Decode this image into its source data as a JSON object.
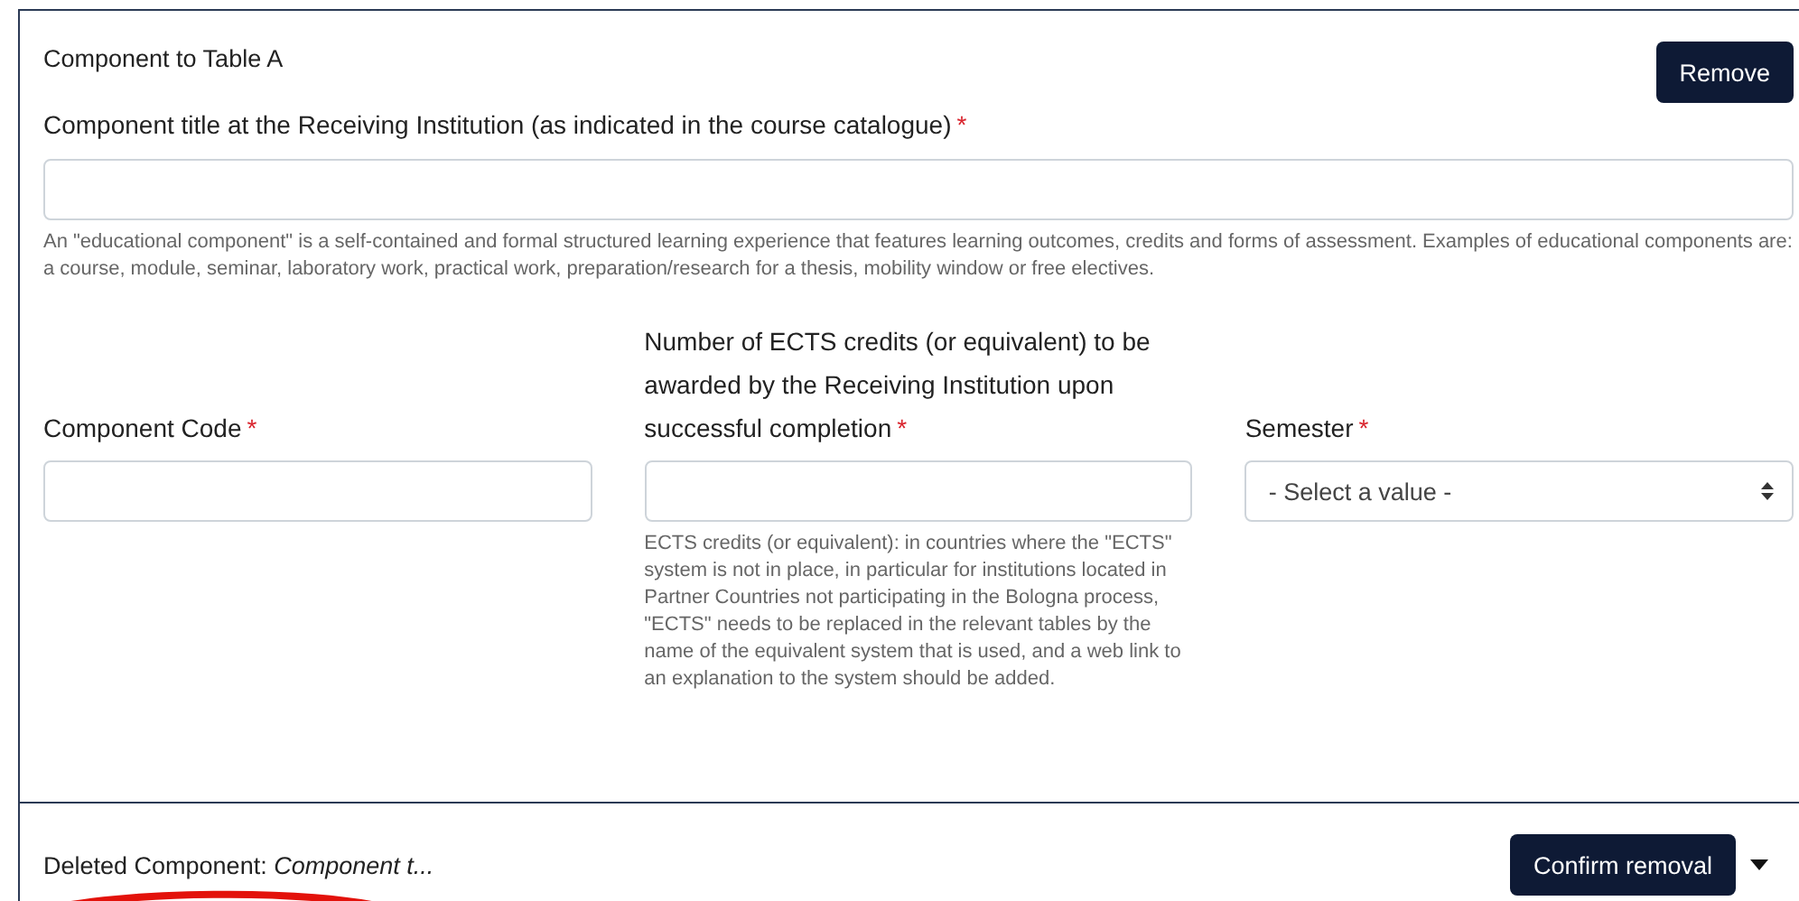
{
  "component": {
    "heading": "Component to Table A",
    "remove_button": "Remove",
    "title_field": {
      "label": "Component title at the Receiving Institution (as indicated in the course catalogue)",
      "required_mark": "*",
      "help": "An \"educational component\" is a self-contained and formal structured learning experience that features learning outcomes, credits and forms of assessment. Examples of educational components are: a course, module, seminar, laboratory work, practical work, preparation/research for a thesis, mobility window or free electives."
    },
    "fields": [
      {
        "kind": "text",
        "label": "Component Code",
        "required_mark": "*"
      },
      {
        "kind": "text",
        "label": "Number of ECTS credits (or equivalent) to be awarded by the Receiving Institution upon successful completion",
        "required_mark": "*",
        "help": "ECTS credits (or equivalent): in countries where the \"ECTS\" system is not in place, in particular for institutions located in Partner Countries not participating in the Bologna process, \"ECTS\" needs to be replaced in the relevant tables by the name of the equivalent system that is used, and a web link to an explanation to the system should be added."
      },
      {
        "kind": "select",
        "label": "Semester",
        "required_mark": "*",
        "value": "- Select a value -"
      }
    ]
  },
  "deleted": {
    "label": "Deleted Component: ",
    "name": "Component t...",
    "confirm_button": "Confirm removal"
  }
}
